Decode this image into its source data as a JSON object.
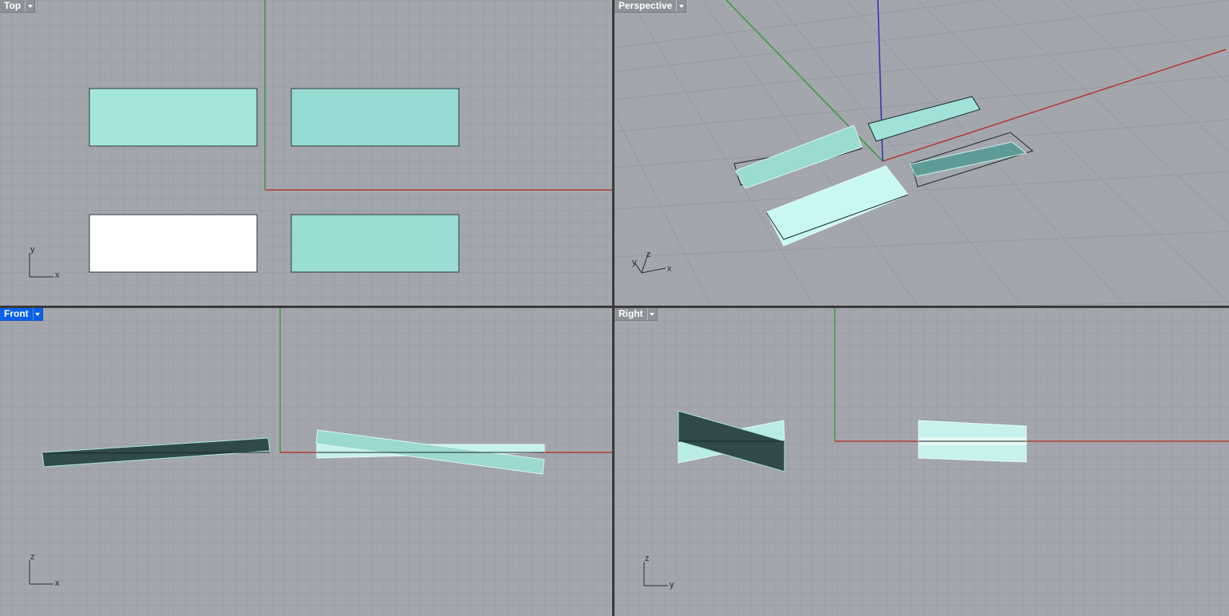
{
  "viewports": {
    "top": {
      "label": "Top",
      "axis_labels": {
        "vertical": "y",
        "horizontal": "x"
      }
    },
    "perspective": {
      "label": "Perspective",
      "axis_labels": {
        "z": "z",
        "y": "y",
        "x": "x"
      }
    },
    "front": {
      "label": "Front",
      "active": true,
      "axis_labels": {
        "vertical": "z",
        "horizontal": "x"
      }
    },
    "right": {
      "label": "Right",
      "axis_labels": {
        "vertical": "z",
        "horizontal": "y"
      }
    }
  },
  "icons": {
    "viewport_menu": "triangle-down-icon"
  },
  "colors": {
    "viewport_bg": "#a3a6ad",
    "grid_line": "#9699a0",
    "active_label": "#0a60e8",
    "axis_x": "#b23a32",
    "axis_y": "#3a9a3a",
    "axis_z": "#3030b0",
    "surface_light": "#a4e6de",
    "surface_mid": "#96dbd3",
    "surface_dark": "#2f4a48",
    "surface_highlight": "#ffffff"
  }
}
